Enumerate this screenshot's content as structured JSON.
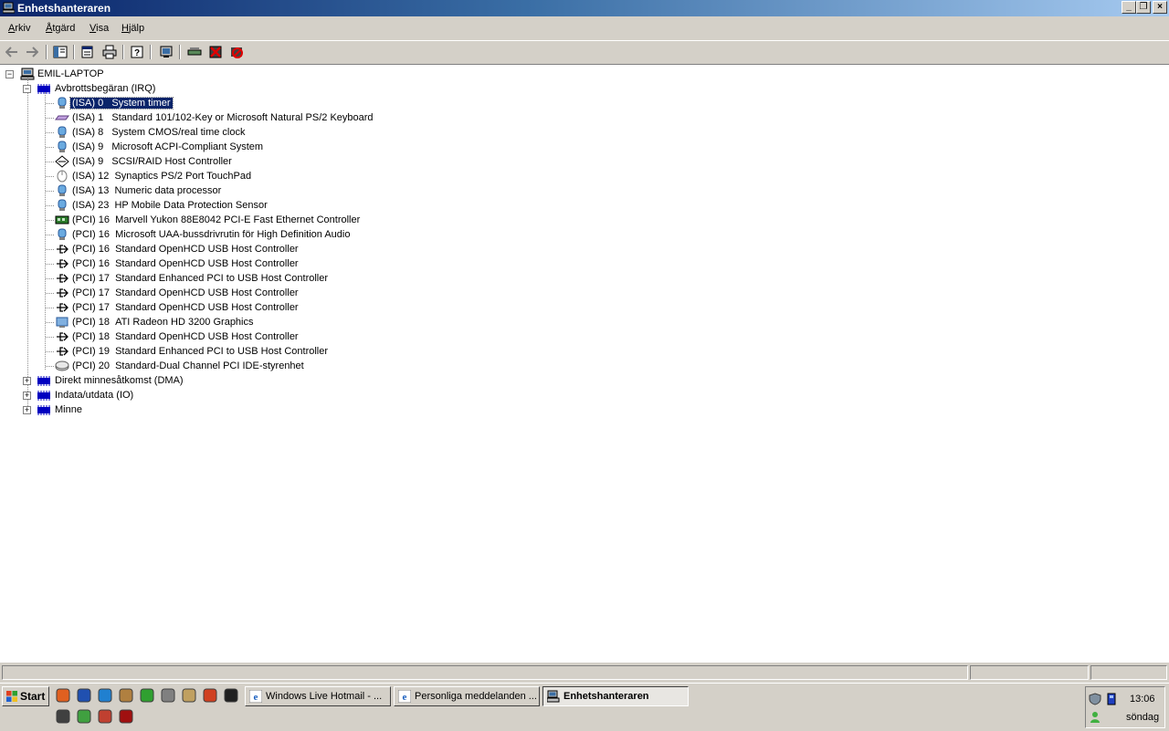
{
  "window": {
    "title": "Enhetshanteraren",
    "controls": [
      "_",
      "❐",
      "×"
    ]
  },
  "menu": {
    "items": [
      {
        "label": "Arkiv",
        "accel": "A",
        "rest": "rkiv"
      },
      {
        "label": "Åtgärd",
        "accel": "Å",
        "rest": "tgärd"
      },
      {
        "label": "Visa",
        "accel": "V",
        "rest": "isa"
      },
      {
        "label": "Hjälp",
        "accel": "H",
        "rest": "jälp"
      }
    ]
  },
  "toolbar": {
    "icons": [
      "back-icon",
      "forward-icon",
      "show-hide-console-tree-icon",
      "properties-icon",
      "print-icon",
      "help-icon",
      "scan-hardware-icon",
      "update-driver-icon",
      "uninstall-icon",
      "disable-icon"
    ]
  },
  "tree": {
    "root": "EMIL-LAPTOP",
    "irq_group": "Avbrottsbegäran (IRQ)",
    "irq_items": [
      {
        "bus": "(ISA)",
        "irq": "0",
        "name": "System timer",
        "icon": "system-device-icon",
        "selected": true
      },
      {
        "bus": "(ISA)",
        "irq": "1",
        "name": "Standard 101/102-Key or Microsoft Natural PS/2 Keyboard",
        "icon": "keyboard-icon"
      },
      {
        "bus": "(ISA)",
        "irq": "8",
        "name": "System CMOS/real time clock",
        "icon": "system-device-icon"
      },
      {
        "bus": "(ISA)",
        "irq": "9",
        "name": "Microsoft ACPI-Compliant System",
        "icon": "system-device-icon"
      },
      {
        "bus": "(ISA)",
        "irq": "9",
        "name": "SCSI/RAID Host Controller",
        "icon": "scsi-controller-icon"
      },
      {
        "bus": "(ISA)",
        "irq": "12",
        "name": "Synaptics PS/2 Port TouchPad",
        "icon": "mouse-icon"
      },
      {
        "bus": "(ISA)",
        "irq": "13",
        "name": "Numeric data processor",
        "icon": "system-device-icon"
      },
      {
        "bus": "(ISA)",
        "irq": "23",
        "name": "HP Mobile Data Protection Sensor",
        "icon": "system-device-icon"
      },
      {
        "bus": "(PCI)",
        "irq": "16",
        "name": "Marvell Yukon 88E8042 PCI-E Fast Ethernet Controller",
        "icon": "network-adapter-icon"
      },
      {
        "bus": "(PCI)",
        "irq": "16",
        "name": "Microsoft UAA-bussdrivrutin för High Definition Audio",
        "icon": "system-device-icon"
      },
      {
        "bus": "(PCI)",
        "irq": "16",
        "name": "Standard OpenHCD USB Host Controller",
        "icon": "usb-icon"
      },
      {
        "bus": "(PCI)",
        "irq": "16",
        "name": "Standard OpenHCD USB Host Controller",
        "icon": "usb-icon"
      },
      {
        "bus": "(PCI)",
        "irq": "17",
        "name": "Standard Enhanced PCI to USB Host Controller",
        "icon": "usb-icon"
      },
      {
        "bus": "(PCI)",
        "irq": "17",
        "name": "Standard OpenHCD USB Host Controller",
        "icon": "usb-icon"
      },
      {
        "bus": "(PCI)",
        "irq": "17",
        "name": "Standard OpenHCD USB Host Controller",
        "icon": "usb-icon"
      },
      {
        "bus": "(PCI)",
        "irq": "18",
        "name": "ATI Radeon HD 3200 Graphics",
        "icon": "display-adapter-icon"
      },
      {
        "bus": "(PCI)",
        "irq": "18",
        "name": "Standard OpenHCD USB Host Controller",
        "icon": "usb-icon"
      },
      {
        "bus": "(PCI)",
        "irq": "19",
        "name": "Standard Enhanced PCI to USB Host Controller",
        "icon": "usb-icon"
      },
      {
        "bus": "(PCI)",
        "irq": "20",
        "name": "Standard-Dual Channel PCI IDE-styrenhet",
        "icon": "ide-controller-icon"
      }
    ],
    "collapsed_groups": [
      "Direkt minnesåtkomst (DMA)",
      "Indata/utdata (IO)",
      "Minne"
    ]
  },
  "taskbar": {
    "start_label": "Start",
    "quicklaunch_icons": [
      "firefox-icon",
      "word-icon",
      "network-icon",
      "game-icon",
      "green-app-icon",
      "scanner-icon",
      "flag-app-icon",
      "red-swirl-icon",
      "steam-icon",
      "camera-icon",
      "people-icon",
      "house-icon",
      "red-app-icon"
    ],
    "buttons": [
      {
        "label": "Windows Live Hotmail - ...",
        "icon": "ie-icon",
        "active": false
      },
      {
        "label": "Personliga meddelanden ...",
        "icon": "ie-icon",
        "active": false
      },
      {
        "label": "Enhetshanteraren",
        "icon": "device-manager-icon",
        "active": true
      }
    ],
    "tray": {
      "time": "13:06",
      "day": "söndag",
      "icons": [
        "security-icon",
        "device-icon",
        "messenger-icon"
      ]
    }
  },
  "colors": {
    "title_start": "#0a246a",
    "title_end": "#a6caf0",
    "selection": "#0a246a",
    "chrome": "#d4d0c8"
  }
}
